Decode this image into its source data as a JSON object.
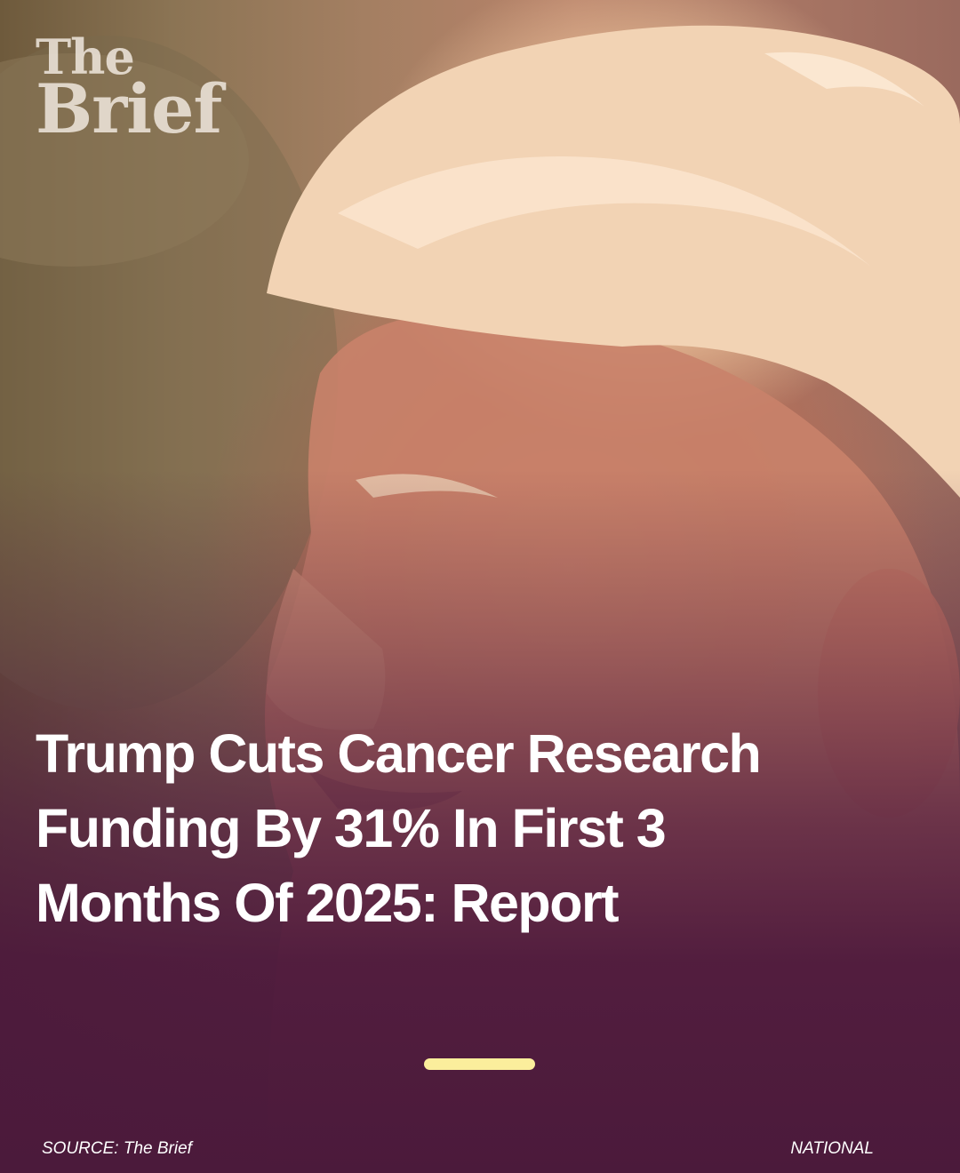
{
  "brand": {
    "line1": "The",
    "line2": "Brief"
  },
  "headline": "Trump Cuts Cancer Research Funding By 31% In First 3 Months Of 2025: Report",
  "footer": {
    "source": "SOURCE: The Brief",
    "category": "NATIONAL"
  },
  "colors": {
    "accent_bar": "#fbee9c",
    "overlay": "#4b1a3b",
    "text": "#ffffff"
  }
}
